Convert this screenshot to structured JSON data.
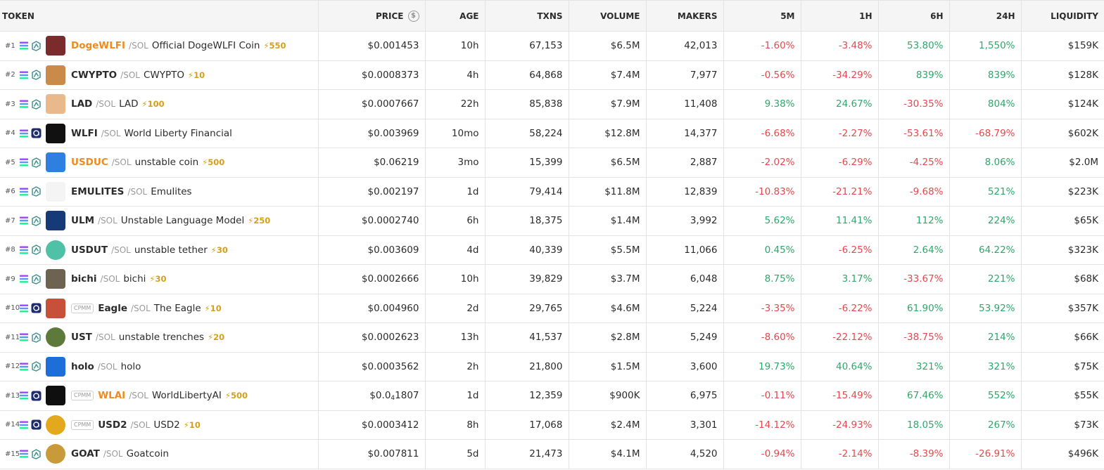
{
  "header": {
    "token": "TOKEN",
    "price": "PRICE",
    "age": "AGE",
    "txns": "TXNS",
    "volume": "VOLUME",
    "makers": "MAKERS",
    "m5": "5M",
    "h1": "1H",
    "h6": "6H",
    "h24": "24H",
    "liquidity": "LIQUIDITY",
    "price_icon": "dollar-circle-icon",
    "price_icon_glyph": "$"
  },
  "colors": {
    "positive": "#2ea76a",
    "negative": "#e5484d",
    "boost": "#d4a017",
    "highlight": "#f08a1c"
  },
  "rows": [
    {
      "rank": "#1",
      "sym": "DogeWLFI",
      "pair": "/SOL",
      "name": "Official DogeWLFI Coin",
      "boost": "⚡550",
      "tag": "",
      "price": "$0.001453",
      "age": "10h",
      "txns": "67,153",
      "volume": "$6.5M",
      "makers": "42,013",
      "m5": "-1.60%",
      "h1": "-3.48%",
      "h6": "53.80%",
      "h24": "1,550%",
      "liq": "$159K",
      "highlight": true,
      "dex": "raydium",
      "avatar_color": "#7a2b2b",
      "avatar_round": false
    },
    {
      "rank": "#2",
      "sym": "CWYPTO",
      "pair": "/SOL",
      "name": "CWYPTO",
      "boost": "⚡10",
      "tag": "",
      "price": "$0.0008373",
      "age": "4h",
      "txns": "64,868",
      "volume": "$7.4M",
      "makers": "7,977",
      "m5": "-0.56%",
      "h1": "-34.29%",
      "h6": "839%",
      "h24": "839%",
      "liq": "$128K",
      "highlight": false,
      "dex": "raydium",
      "avatar_color": "#c98a4a",
      "avatar_round": false
    },
    {
      "rank": "#3",
      "sym": "LAD",
      "pair": "/SOL",
      "name": "LAD",
      "boost": "⚡100",
      "tag": "",
      "price": "$0.0007667",
      "age": "22h",
      "txns": "85,838",
      "volume": "$7.9M",
      "makers": "11,408",
      "m5": "9.38%",
      "h1": "24.67%",
      "h6": "-30.35%",
      "h24": "804%",
      "liq": "$124K",
      "highlight": false,
      "dex": "raydium",
      "avatar_color": "#e8b98a",
      "avatar_round": false
    },
    {
      "rank": "#4",
      "sym": "WLFI",
      "pair": "/SOL",
      "name": "World Liberty Financial",
      "boost": "",
      "tag": "",
      "price": "$0.003969",
      "age": "10mo",
      "txns": "58,224",
      "volume": "$12.8M",
      "makers": "14,377",
      "m5": "-6.68%",
      "h1": "-2.27%",
      "h6": "-53.61%",
      "h24": "-68.79%",
      "liq": "$602K",
      "highlight": false,
      "dex": "meteora",
      "avatar_color": "#111111",
      "avatar_round": false
    },
    {
      "rank": "#5",
      "sym": "USDUC",
      "pair": "/SOL",
      "name": "unstable coin",
      "boost": "⚡500",
      "tag": "",
      "price": "$0.06219",
      "age": "3mo",
      "txns": "15,399",
      "volume": "$6.5M",
      "makers": "2,887",
      "m5": "-2.02%",
      "h1": "-6.29%",
      "h6": "-4.25%",
      "h24": "8.06%",
      "liq": "$2.0M",
      "highlight": true,
      "dex": "raydium",
      "avatar_color": "#2f7fe0",
      "avatar_round": false
    },
    {
      "rank": "#6",
      "sym": "EMULITES",
      "pair": "/SOL",
      "name": "Emulites",
      "boost": "",
      "tag": "",
      "price": "$0.002197",
      "age": "1d",
      "txns": "79,414",
      "volume": "$11.8M",
      "makers": "12,839",
      "m5": "-10.83%",
      "h1": "-21.21%",
      "h6": "-9.68%",
      "h24": "521%",
      "liq": "$223K",
      "highlight": false,
      "dex": "raydium",
      "avatar_color": "#f4f4f4",
      "avatar_round": false
    },
    {
      "rank": "#7",
      "sym": "ULM",
      "pair": "/SOL",
      "name": "Unstable Language Model",
      "boost": "⚡250",
      "tag": "",
      "price": "$0.0002740",
      "age": "6h",
      "txns": "18,375",
      "volume": "$1.4M",
      "makers": "3,992",
      "m5": "5.62%",
      "h1": "11.41%",
      "h6": "112%",
      "h24": "224%",
      "liq": "$65K",
      "highlight": false,
      "dex": "raydium",
      "avatar_color": "#163a78",
      "avatar_round": false
    },
    {
      "rank": "#8",
      "sym": "USDUT",
      "pair": "/SOL",
      "name": "unstable tether",
      "boost": "⚡30",
      "tag": "",
      "price": "$0.003609",
      "age": "4d",
      "txns": "40,339",
      "volume": "$5.5M",
      "makers": "11,066",
      "m5": "0.45%",
      "h1": "-6.25%",
      "h6": "2.64%",
      "h24": "64.22%",
      "liq": "$323K",
      "highlight": false,
      "dex": "raydium",
      "avatar_color": "#4fc1a6",
      "avatar_round": true
    },
    {
      "rank": "#9",
      "sym": "bichi",
      "pair": "/SOL",
      "name": "bichi",
      "boost": "⚡30",
      "tag": "",
      "price": "$0.0002666",
      "age": "10h",
      "txns": "39,829",
      "volume": "$3.7M",
      "makers": "6,048",
      "m5": "8.75%",
      "h1": "3.17%",
      "h6": "-33.67%",
      "h24": "221%",
      "liq": "$68K",
      "highlight": false,
      "dex": "raydium",
      "avatar_color": "#6d6350",
      "avatar_round": false
    },
    {
      "rank": "#10",
      "sym": "Eagle",
      "pair": "/SOL",
      "name": "The Eagle",
      "boost": "⚡10",
      "tag": "CPMM",
      "price": "$0.004960",
      "age": "2d",
      "txns": "29,765",
      "volume": "$4.6M",
      "makers": "5,224",
      "m5": "-3.35%",
      "h1": "-6.22%",
      "h6": "61.90%",
      "h24": "53.92%",
      "liq": "$357K",
      "highlight": false,
      "dex": "meteora",
      "avatar_color": "#c6503a",
      "avatar_round": false
    },
    {
      "rank": "#11",
      "sym": "UST",
      "pair": "/SOL",
      "name": "unstable trenches",
      "boost": "⚡20",
      "tag": "",
      "price": "$0.0002623",
      "age": "13h",
      "txns": "41,537",
      "volume": "$2.8M",
      "makers": "5,249",
      "m5": "-8.60%",
      "h1": "-22.12%",
      "h6": "-38.75%",
      "h24": "214%",
      "liq": "$66K",
      "highlight": false,
      "dex": "raydium",
      "avatar_color": "#5d7a3a",
      "avatar_round": true
    },
    {
      "rank": "#12",
      "sym": "holo",
      "pair": "/SOL",
      "name": "holo",
      "boost": "",
      "tag": "",
      "price": "$0.0003562",
      "age": "2h",
      "txns": "21,800",
      "volume": "$1.5M",
      "makers": "3,600",
      "m5": "19.73%",
      "h1": "40.64%",
      "h6": "321%",
      "h24": "321%",
      "liq": "$75K",
      "highlight": false,
      "dex": "raydium",
      "avatar_color": "#1c6fd8",
      "avatar_round": false
    },
    {
      "rank": "#13",
      "sym": "WLAI",
      "pair": "/SOL",
      "name": "WorldLibertyAI",
      "boost": "⚡500",
      "tag": "CPMM",
      "price_pre": "$0.0",
      "price_sub": "4",
      "price_post": "1807",
      "age": "1d",
      "txns": "12,359",
      "volume": "$900K",
      "makers": "6,975",
      "m5": "-0.11%",
      "h1": "-15.49%",
      "h6": "67.46%",
      "h24": "552%",
      "liq": "$55K",
      "highlight": true,
      "dex": "meteora",
      "avatar_color": "#0f0f0f",
      "avatar_round": false
    },
    {
      "rank": "#14",
      "sym": "USD2",
      "pair": "/SOL",
      "name": "USD2",
      "boost": "⚡10",
      "tag": "CPMM",
      "price": "$0.0003412",
      "age": "8h",
      "txns": "17,068",
      "volume": "$2.4M",
      "makers": "3,301",
      "m5": "-14.12%",
      "h1": "-24.93%",
      "h6": "18.05%",
      "h24": "267%",
      "liq": "$73K",
      "highlight": false,
      "dex": "meteora",
      "avatar_color": "#e3a81c",
      "avatar_round": true
    },
    {
      "rank": "#15",
      "sym": "GOAT",
      "pair": "/SOL",
      "name": "Goatcoin",
      "boost": "",
      "tag": "",
      "price": "$0.007811",
      "age": "5d",
      "txns": "21,473",
      "volume": "$4.1M",
      "makers": "4,520",
      "m5": "-0.94%",
      "h1": "-2.14%",
      "h6": "-8.39%",
      "h24": "-26.91%",
      "liq": "$496K",
      "highlight": false,
      "dex": "raydium",
      "avatar_color": "#c89a3a",
      "avatar_round": true
    }
  ]
}
